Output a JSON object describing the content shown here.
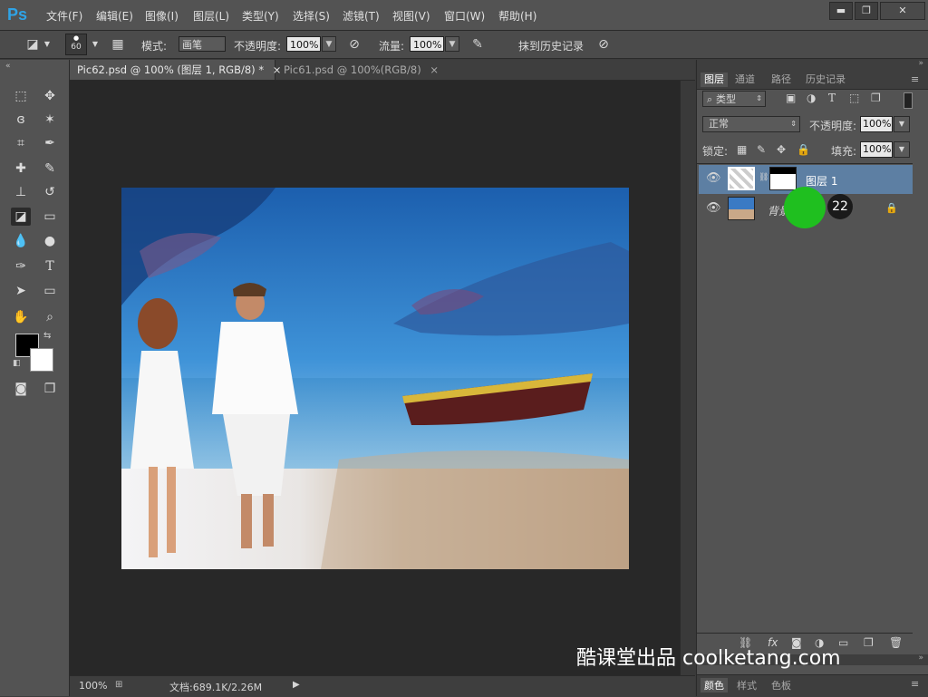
{
  "app": {
    "logo": "Ps",
    "menu": [
      "文件(F)",
      "编辑(E)",
      "图像(I)",
      "图层(L)",
      "类型(Y)",
      "选择(S)",
      "滤镜(T)",
      "视图(V)",
      "窗口(W)",
      "帮助(H)"
    ],
    "window_controls": {
      "minimize": "▬",
      "restore": "❐",
      "close": "✕"
    }
  },
  "options_bar": {
    "brush_size": "60",
    "mode_label": "模式:",
    "mode_value": "画笔",
    "opacity_label": "不透明度:",
    "opacity_value": "100%",
    "flow_label": "流量:",
    "flow_value": "100%",
    "erase_history_label": "抹到历史记录"
  },
  "tabs": [
    {
      "label": "Pic62.psd @ 100% (图层 1, RGB/8) *",
      "close": "×",
      "active": true
    },
    {
      "label": "Pic61.psd @ 100%(RGB/8)",
      "close": "×",
      "active": false
    }
  ],
  "status": {
    "zoom": "100%",
    "doc_info": "文档:689.1K/2.26M"
  },
  "panel": {
    "tabs": [
      "图层",
      "通道",
      "路径",
      "历史记录"
    ],
    "filter_kind": "类型",
    "blend_mode": "正常",
    "opacity_label": "不透明度:",
    "opacity_value": "100%",
    "lock_label": "锁定:",
    "fill_label": "填充:",
    "fill_value": "100%",
    "layers": [
      {
        "name": "图层 1",
        "selected": true
      },
      {
        "name": "背景",
        "locked": true
      }
    ],
    "bottom_tabs": [
      "颜色",
      "样式",
      "色板"
    ]
  },
  "overlay": {
    "step_number": "22",
    "watermark": "酷课堂出品 coolketang.com"
  },
  "colors": {
    "ps_blue": "#2fa3e6",
    "selected_layer": "#5d7fa3",
    "marker_green": "#1fbf1f"
  }
}
